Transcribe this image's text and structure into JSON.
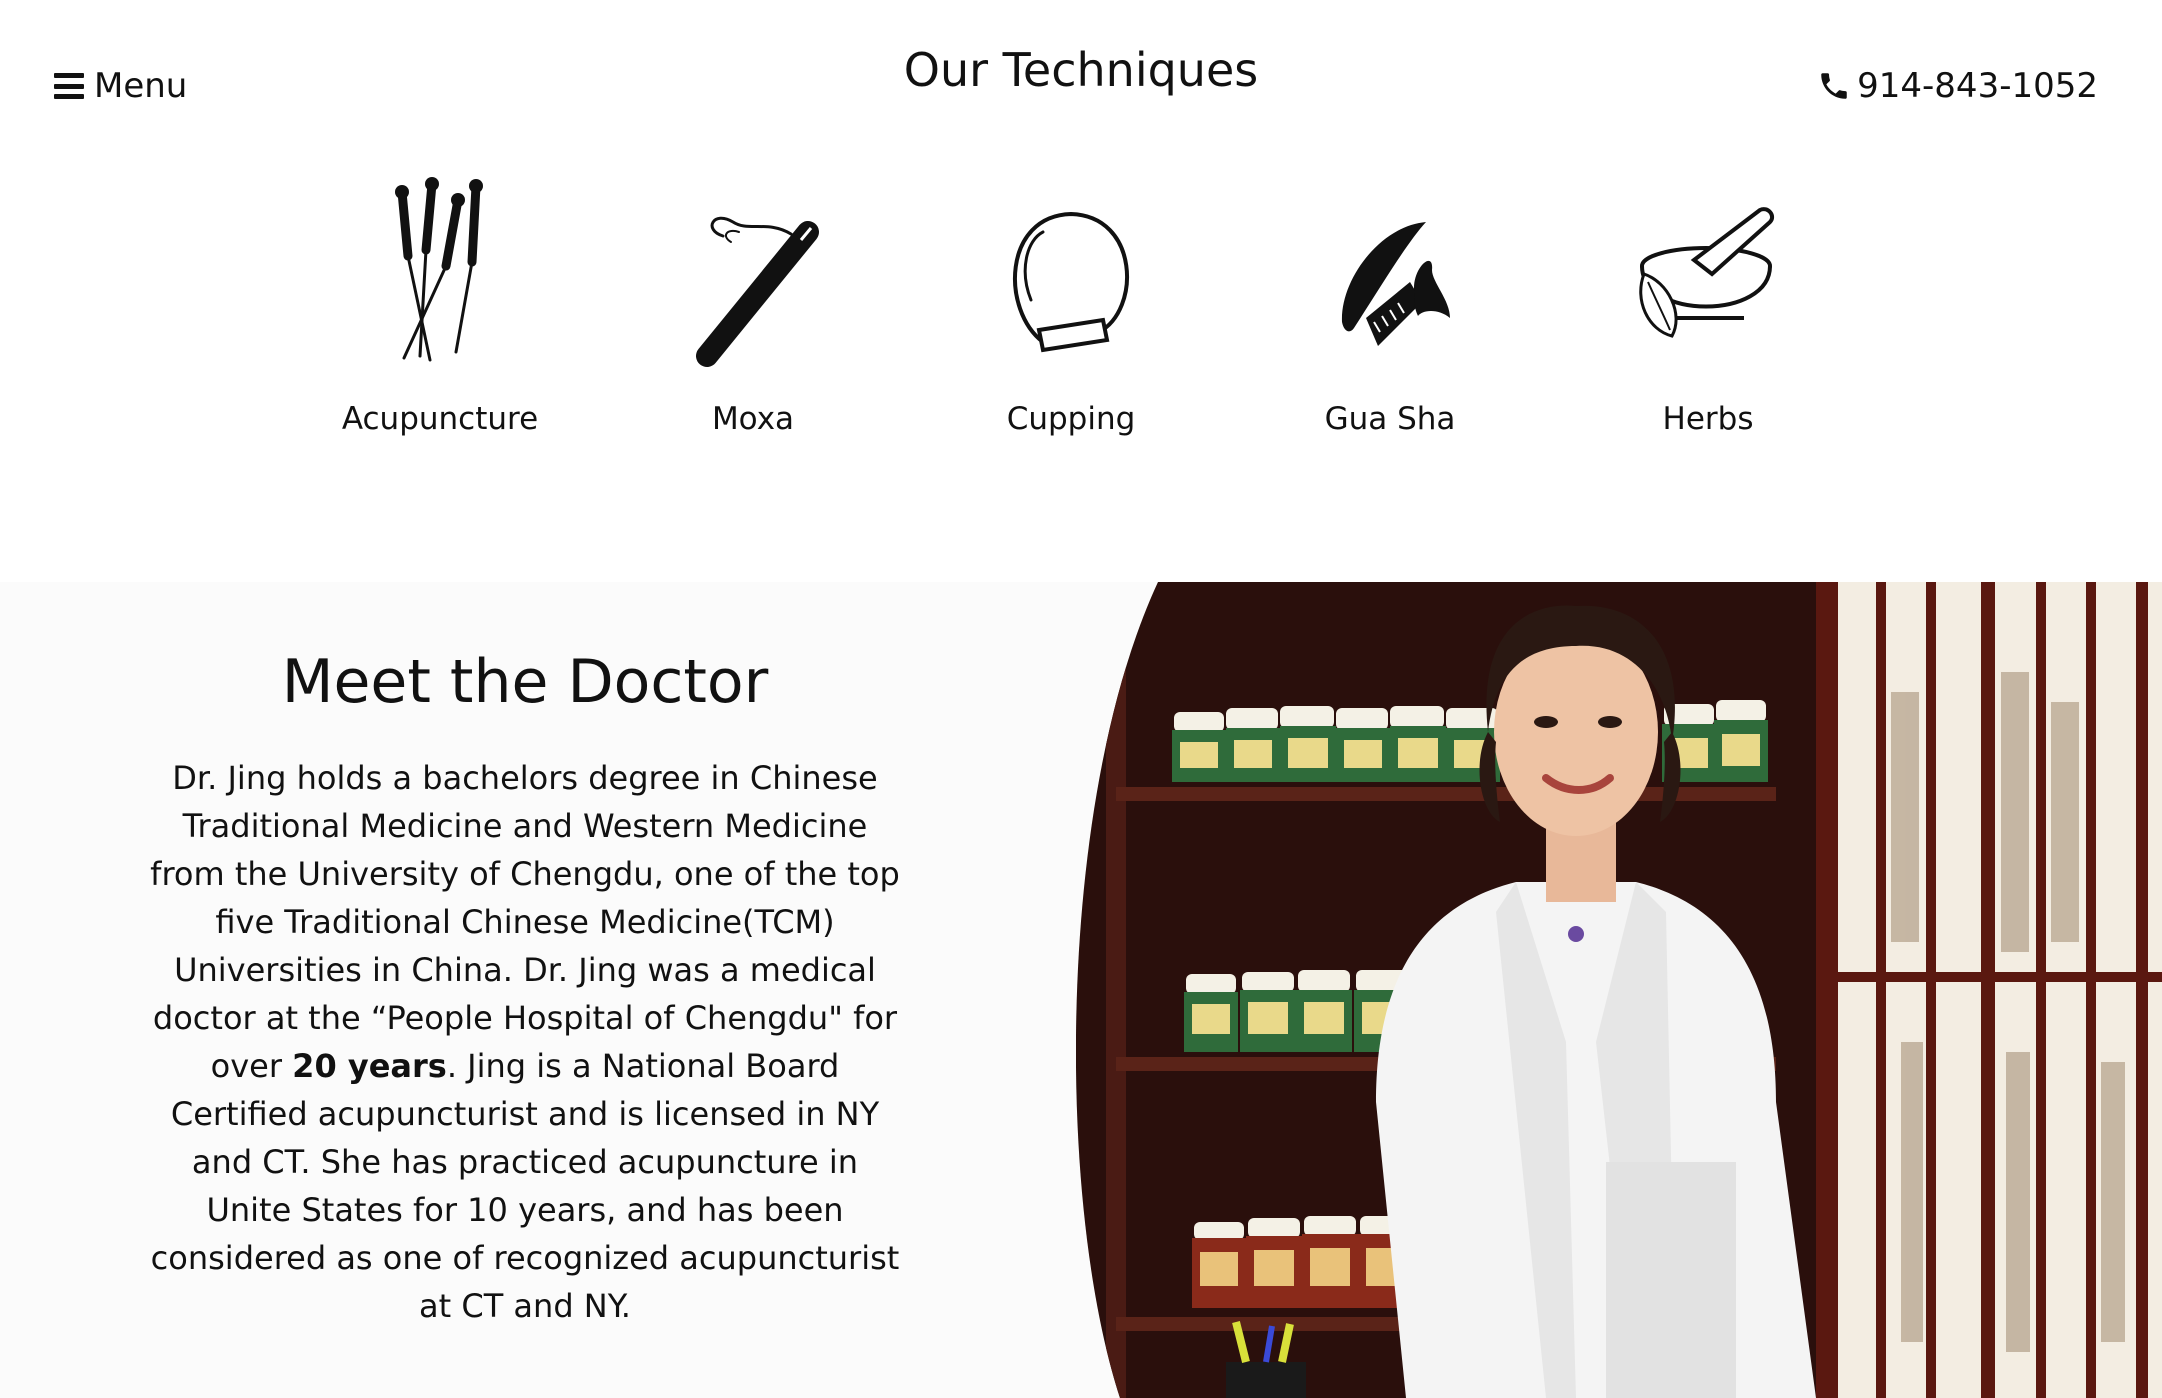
{
  "header": {
    "menu_label": "Menu",
    "title": "Our Techniques",
    "phone": "914-843-1052"
  },
  "techniques": [
    {
      "label": "Acupuncture",
      "icon": "acupuncture-needles-icon"
    },
    {
      "label": "Moxa",
      "icon": "moxa-stick-icon"
    },
    {
      "label": "Cupping",
      "icon": "cupping-glass-icon"
    },
    {
      "label": "Gua Sha",
      "icon": "gua-sha-tools-icon"
    },
    {
      "label": "Herbs",
      "icon": "mortar-pestle-icon"
    }
  ],
  "doctor": {
    "heading": "Meet the Doctor",
    "bio_part1": "Dr. Jing holds a bachelors degree in Chinese Traditional Medicine and Western Medicine from the University of Chengdu, one of the top five Traditional Chinese Medicine(TCM) Universities in China. Dr. Jing was a medical doctor at the “People Hospital of Chengdu\" for over ",
    "bio_bold": "20 years",
    "bio_part2": ". Jing is a National Board Certified acupuncturist and is licensed in NY and CT. She has practiced acupuncture in Unite States for 10 years, and has been considered as one of recognized acupuncturist at CT and NY."
  },
  "colors": {
    "text": "#111111",
    "section_bg": "#fbfbfb",
    "shelf_wood": "#3a1712",
    "screen_frame": "#5a1810",
    "coat": "#f4f4f4"
  }
}
